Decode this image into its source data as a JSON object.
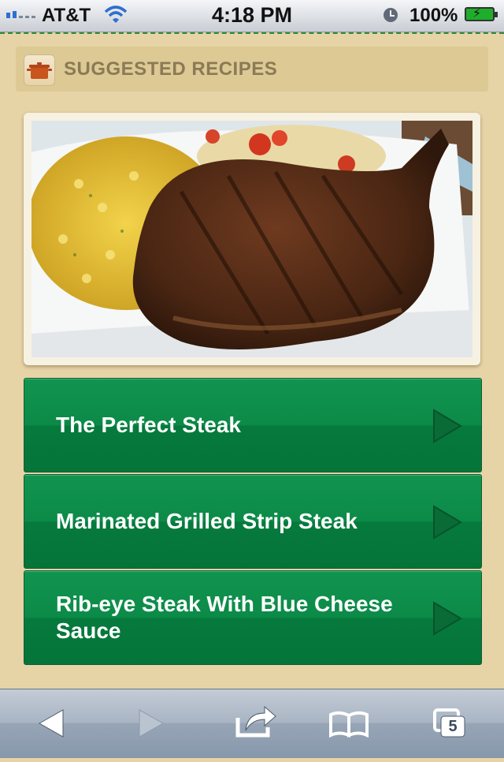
{
  "status_bar": {
    "carrier": "AT&T",
    "time": "4:18 PM",
    "battery": "100%"
  },
  "header": {
    "title": "SUGGESTED RECIPES",
    "icon": "cooking-pot-icon"
  },
  "photo": {
    "description_icon": "steak-photo"
  },
  "recipes": [
    {
      "label": "The Perfect Steak",
      "icon": "chevron-right-icon"
    },
    {
      "label": "Marinated Grilled Strip Steak",
      "icon": "chevron-right-icon"
    },
    {
      "label": "Rib-eye Steak With Blue Cheese Sauce",
      "icon": "chevron-right-icon"
    }
  ],
  "toolbar": {
    "buttons": [
      "back-icon",
      "forward-icon",
      "share-icon",
      "bookmarks-icon",
      "tabs-icon"
    ],
    "tab_count": "5"
  },
  "colors": {
    "background": "#e6d4a6",
    "header_bg": "#ddc994",
    "header_text": "#8a7a55",
    "recipe_green": "#0c8a48"
  }
}
